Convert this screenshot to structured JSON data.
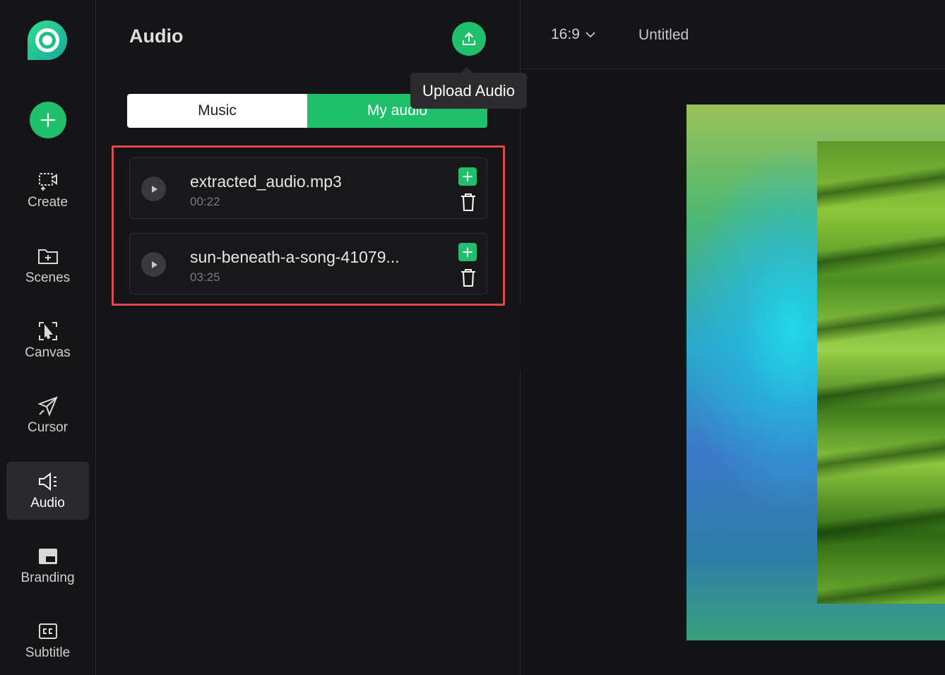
{
  "rail": {
    "items": [
      {
        "label": "Create",
        "icon": "create-video-icon"
      },
      {
        "label": "Scenes",
        "icon": "scenes-folder-icon"
      },
      {
        "label": "Canvas",
        "icon": "canvas-select-icon"
      },
      {
        "label": "Cursor",
        "icon": "cursor-arrow-icon"
      },
      {
        "label": "Audio",
        "icon": "speaker-icon",
        "active": true
      },
      {
        "label": "Branding",
        "icon": "branding-icon"
      },
      {
        "label": "Subtitle",
        "icon": "cc-subtitle-icon"
      }
    ]
  },
  "panel": {
    "title": "Audio",
    "tooltip": "Upload Audio",
    "tabs": [
      {
        "label": "Music",
        "active": false
      },
      {
        "label": "My audio",
        "active": true
      }
    ],
    "files": [
      {
        "name": "extracted_audio.mp3",
        "duration": "00:22"
      },
      {
        "name": "sun-beneath-a-song-41079...",
        "duration": "03:25"
      }
    ]
  },
  "topbar": {
    "ratio": "16:9",
    "doc_title": "Untitled"
  },
  "colors": {
    "accent": "#1fbf6b",
    "highlight": "#e0474c"
  }
}
